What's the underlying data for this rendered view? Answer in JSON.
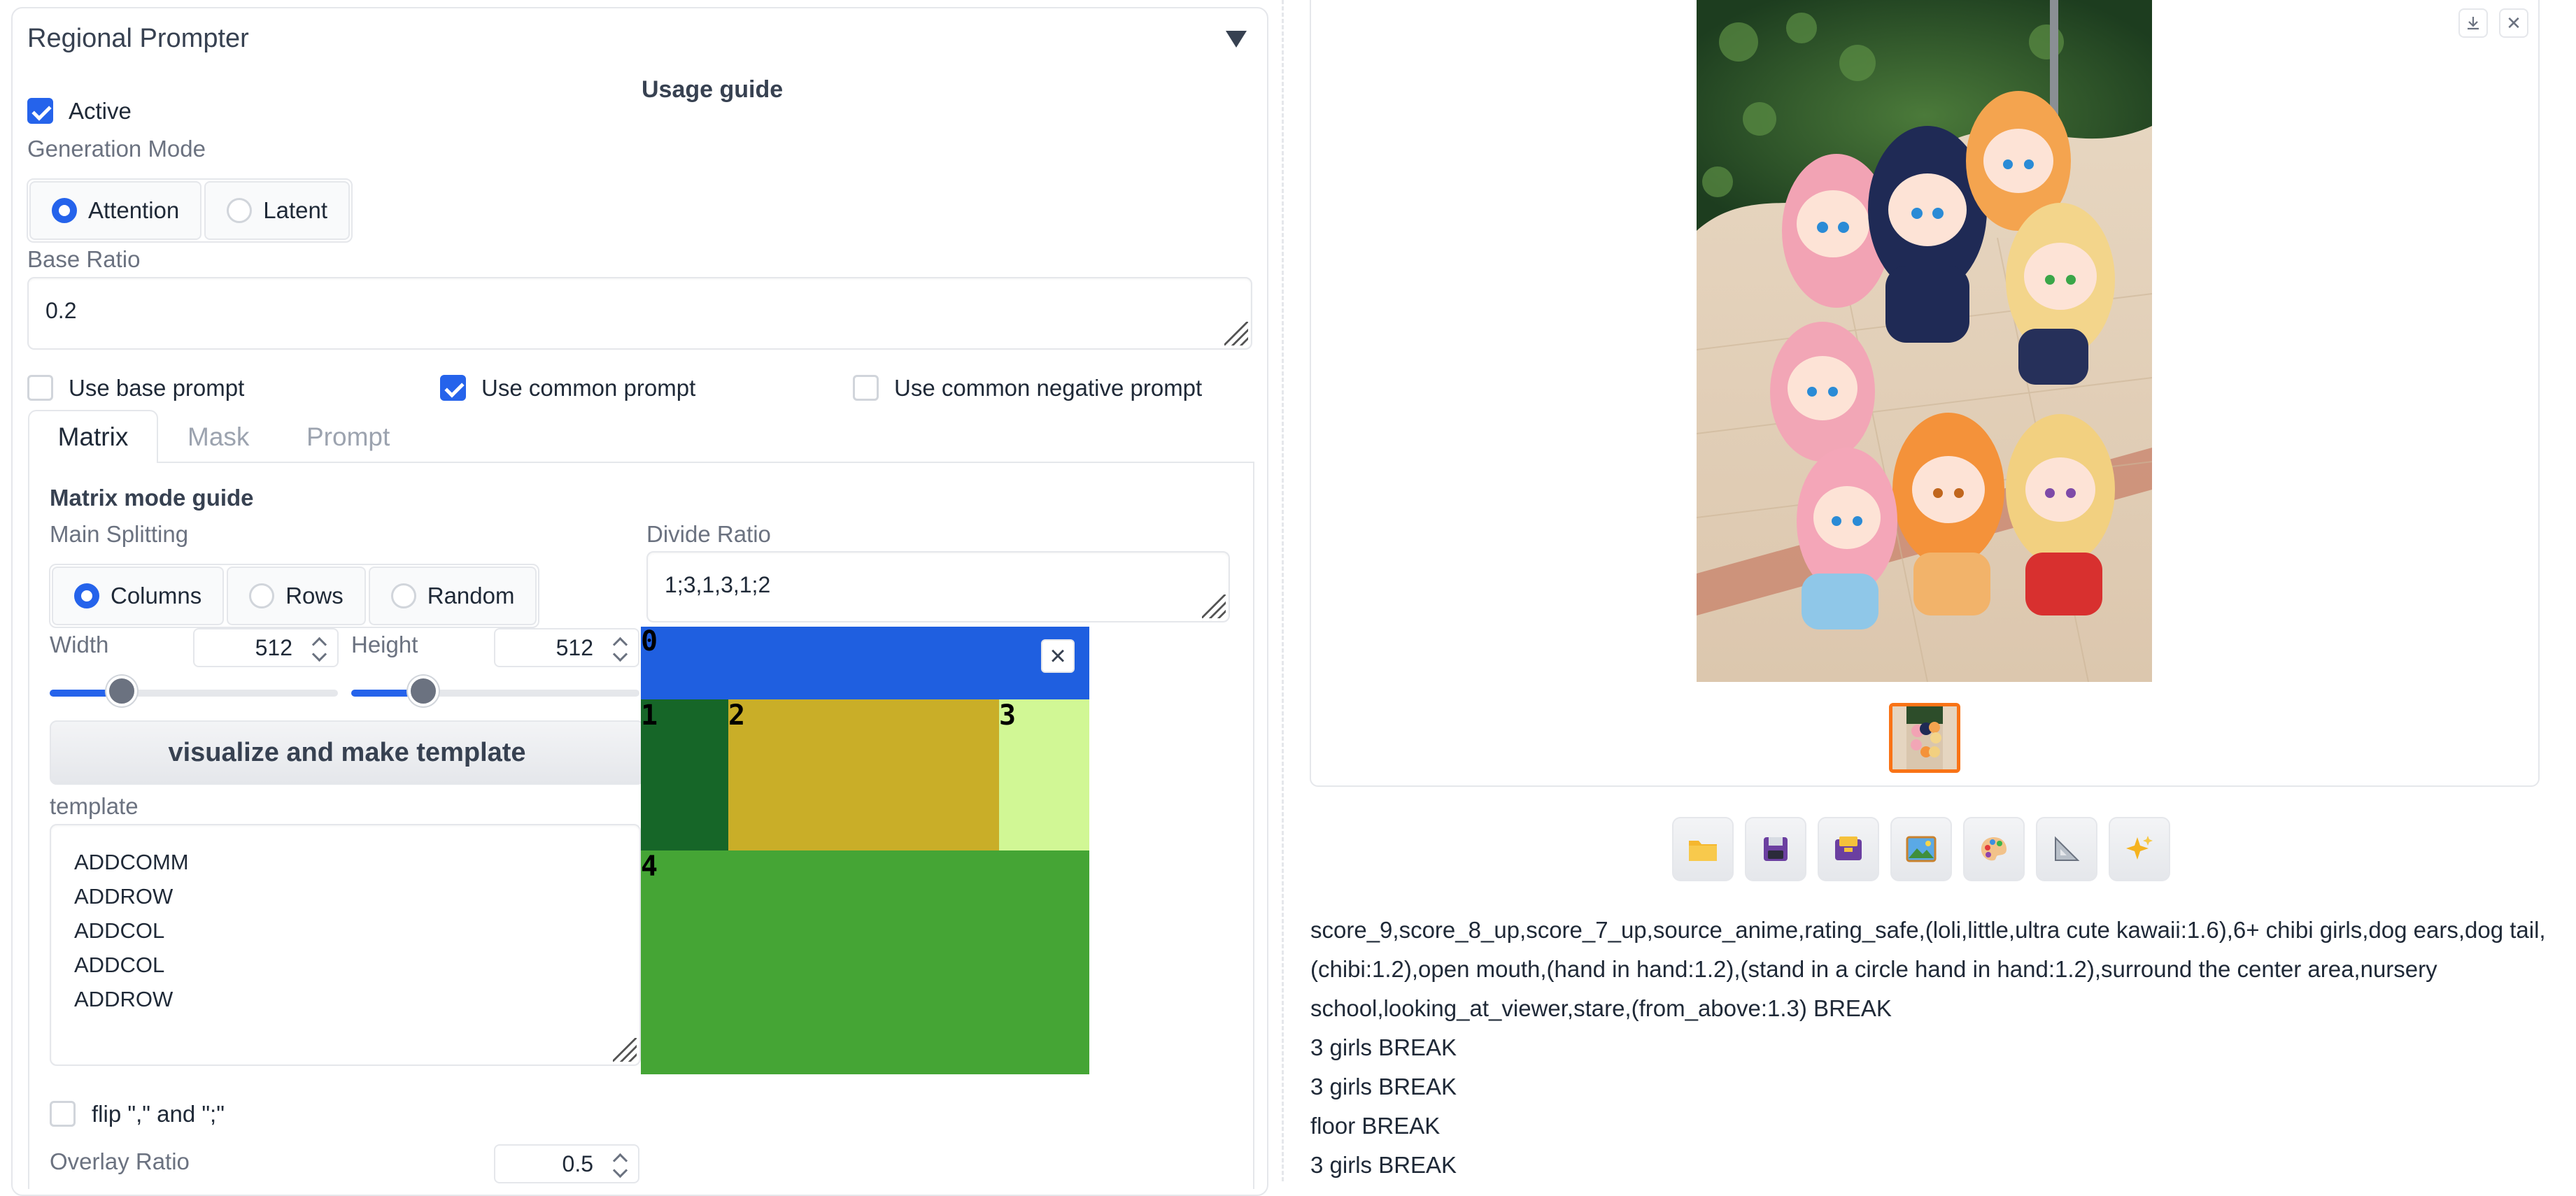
{
  "regional_prompter": {
    "title": "Regional Prompter",
    "usage_guide": "Usage guide",
    "active_label": "Active",
    "active_checked": true,
    "generation_mode": {
      "label": "Generation Mode",
      "options": [
        "Attention",
        "Latent"
      ],
      "selected": "Attention"
    },
    "base_ratio": {
      "label": "Base Ratio",
      "value": "0.2"
    },
    "checkboxes": [
      {
        "label": "Use base prompt",
        "checked": false
      },
      {
        "label": "Use common prompt",
        "checked": true
      },
      {
        "label": "Use common negative prompt",
        "checked": false
      }
    ],
    "tabs": [
      "Matrix",
      "Mask",
      "Prompt"
    ],
    "active_tab": "Matrix",
    "matrix": {
      "guide": "Matrix mode guide",
      "main_splitting": {
        "label": "Main Splitting",
        "options": [
          "Columns",
          "Rows",
          "Random"
        ],
        "selected": "Columns"
      },
      "divide_ratio": {
        "label": "Divide Ratio",
        "value": "1;3,1,3,1;2"
      },
      "width": {
        "label": "Width",
        "value": "512",
        "slider_fraction": 0.25
      },
      "height": {
        "label": "Height",
        "value": "512",
        "slider_fraction": 0.25
      },
      "visualize_button": "visualize and make template",
      "template": {
        "label": "template",
        "lines": [
          "ADDCOMM",
          "ADDROW",
          "ADDCOL",
          "ADDCOL",
          "ADDROW"
        ]
      },
      "flip_label": "flip \",\" and \";\"",
      "flip_checked": false,
      "overlay_ratio": {
        "label": "Overlay Ratio",
        "value": "0.5"
      },
      "visualization": {
        "close_symbol": "×",
        "regions": [
          {
            "num": "0",
            "color": "#1f5fe0"
          },
          {
            "num": "1",
            "color": "#166628"
          },
          {
            "num": "2",
            "color": "#c9ae28"
          },
          {
            "num": "3",
            "color": "#d1f795"
          },
          {
            "num": "4",
            "color": "#45a535"
          }
        ]
      }
    }
  },
  "gallery": {
    "download_icon": "download-icon",
    "close_icon": "close-icon",
    "close_symbol": "✕",
    "toolbar_icons": [
      "folder-icon",
      "save-icon",
      "zip-icon",
      "image-icon",
      "palette-icon",
      "ruler-icon",
      "sparkle-icon"
    ],
    "prompt_lines": [
      "score_9,score_8_up,score_7_up,source_anime,rating_safe,(loli,little,ultra cute kawaii:1.6),6+ chibi girls,dog ears,dog tail,",
      "(chibi:1.2),open mouth,(hand in hand:1.2),(stand in a circle hand in hand:1.2),surround the center area,nursery",
      "school,looking_at_viewer,stare,(from_above:1.3) BREAK",
      "3 girls BREAK",
      "3 girls BREAK",
      "floor BREAK",
      "3 girls BREAK"
    ]
  },
  "colors": {
    "accent": "#2563eb",
    "thumb_border": "#f97316"
  }
}
